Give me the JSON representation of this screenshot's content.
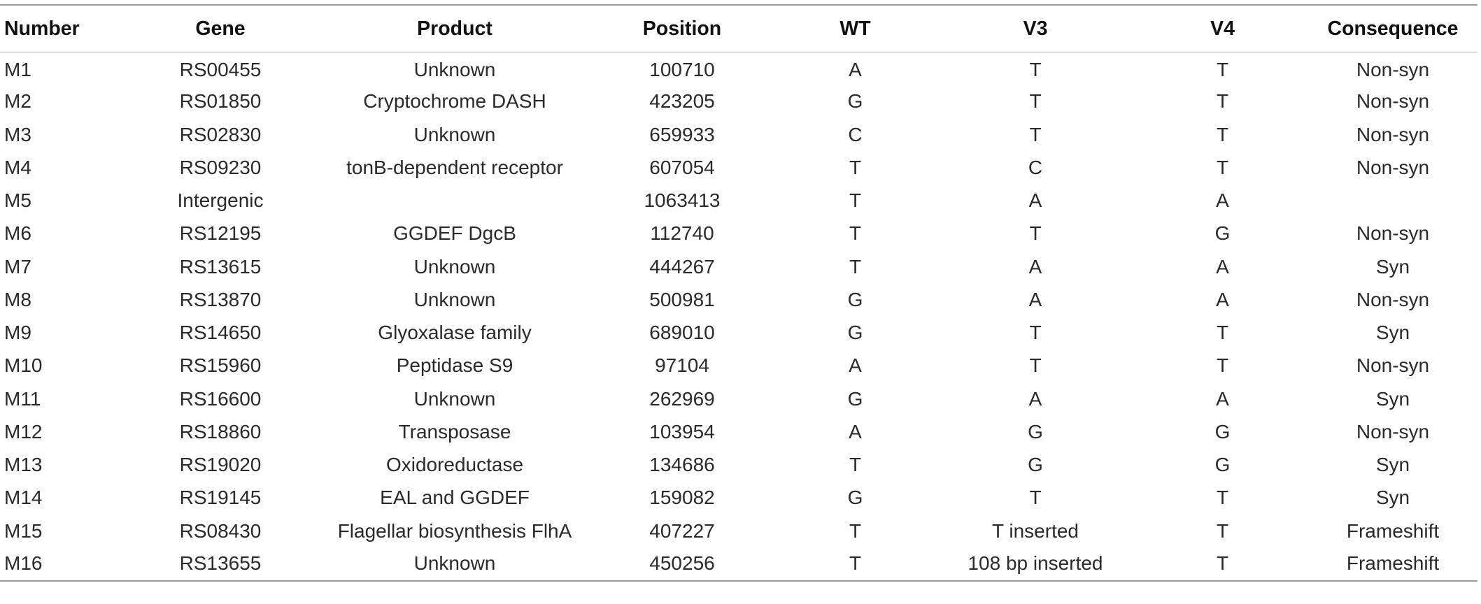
{
  "table": {
    "columns": [
      "Number",
      "Gene",
      "Product",
      "Position",
      "WT",
      "V3",
      "V4",
      "Consequence"
    ],
    "rows": [
      [
        "M1",
        "RS00455",
        "Unknown",
        "100710",
        "A",
        "T",
        "T",
        "Non-syn"
      ],
      [
        "M2",
        "RS01850",
        "Cryptochrome DASH",
        "423205",
        "G",
        "T",
        "T",
        "Non-syn"
      ],
      [
        "M3",
        "RS02830",
        "Unknown",
        "659933",
        "C",
        "T",
        "T",
        "Non-syn"
      ],
      [
        "M4",
        "RS09230",
        "tonB-dependent receptor",
        "607054",
        "T",
        "C",
        "T",
        "Non-syn"
      ],
      [
        "M5",
        "Intergenic",
        "",
        "1063413",
        "T",
        "A",
        "A",
        ""
      ],
      [
        "M6",
        "RS12195",
        "GGDEF DgcB",
        "112740",
        "T",
        "T",
        "G",
        "Non-syn"
      ],
      [
        "M7",
        "RS13615",
        "Unknown",
        "444267",
        "T",
        "A",
        "A",
        "Syn"
      ],
      [
        "M8",
        "RS13870",
        "Unknown",
        "500981",
        "G",
        "A",
        "A",
        "Non-syn"
      ],
      [
        "M9",
        "RS14650",
        "Glyoxalase family",
        "689010",
        "G",
        "T",
        "T",
        "Syn"
      ],
      [
        "M10",
        "RS15960",
        "Peptidase S9",
        "97104",
        "A",
        "T",
        "T",
        "Non-syn"
      ],
      [
        "M11",
        "RS16600",
        "Unknown",
        "262969",
        "G",
        "A",
        "A",
        "Syn"
      ],
      [
        "M12",
        "RS18860",
        "Transposase",
        "103954",
        "A",
        "G",
        "G",
        "Non-syn"
      ],
      [
        "M13",
        "RS19020",
        "Oxidoreductase",
        "134686",
        "T",
        "G",
        "G",
        "Syn"
      ],
      [
        "M14",
        "RS19145",
        "EAL and GGDEF",
        "159082",
        "G",
        "T",
        "T",
        "Syn"
      ],
      [
        "M15",
        "RS08430",
        "Flagellar biosynthesis FlhA",
        "407227",
        "T",
        "T inserted",
        "T",
        "Frameshift"
      ],
      [
        "M16",
        "RS13655",
        "Unknown",
        "450256",
        "T",
        "108 bp inserted",
        "T",
        "Frameshift"
      ]
    ]
  }
}
